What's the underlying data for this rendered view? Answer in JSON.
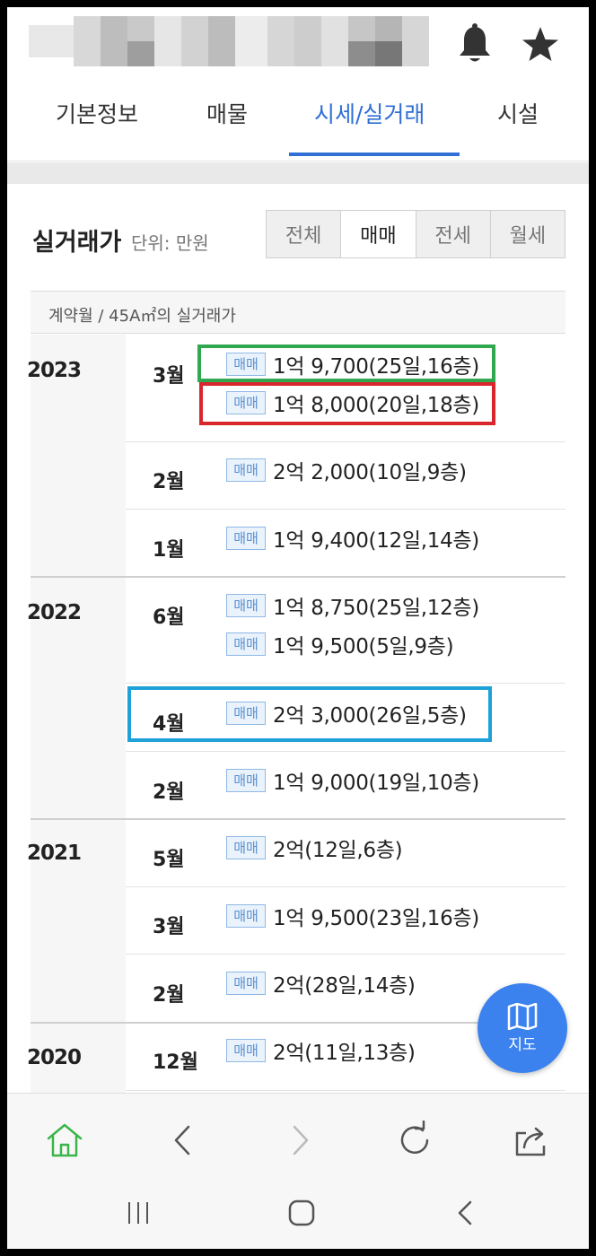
{
  "header": {
    "tabs": [
      {
        "label": "기본정보",
        "active": false
      },
      {
        "label": "매물",
        "active": false
      },
      {
        "label": "시세/실거래",
        "active": true
      },
      {
        "label": "시설",
        "active": false
      }
    ],
    "icons": [
      "bell-icon",
      "star-icon"
    ]
  },
  "section": {
    "title": "실거래가",
    "unit": "단위: 만원",
    "filters": [
      {
        "label": "전체",
        "active": false
      },
      {
        "label": "매매",
        "active": true
      },
      {
        "label": "전세",
        "active": false
      },
      {
        "label": "월세",
        "active": false
      }
    ]
  },
  "table": {
    "header": "계약월 / 45A㎡의 실거래가",
    "badge": "매매",
    "years": [
      {
        "year": "2023",
        "months": [
          {
            "month": "3월",
            "entries": [
              "1억 9,700(25일,16층)",
              "1억 8,000(20일,18층)"
            ]
          },
          {
            "month": "2월",
            "entries": [
              "2억 2,000(10일,9층)"
            ]
          },
          {
            "month": "1월",
            "entries": [
              "1억 9,400(12일,14층)"
            ]
          }
        ]
      },
      {
        "year": "2022",
        "months": [
          {
            "month": "6월",
            "entries": [
              "1억 8,750(25일,12층)",
              "1억 9,500(5일,9층)"
            ]
          },
          {
            "month": "4월",
            "entries": [
              "2억 3,000(26일,5층)"
            ]
          },
          {
            "month": "2월",
            "entries": [
              "1억 9,000(19일,10층)"
            ]
          }
        ]
      },
      {
        "year": "2021",
        "months": [
          {
            "month": "5월",
            "entries": [
              "2억(12일,6층)"
            ]
          },
          {
            "month": "3월",
            "entries": [
              "1억 9,500(23일,16층)"
            ]
          },
          {
            "month": "2월",
            "entries": [
              "2억(28일,14층)"
            ]
          }
        ]
      },
      {
        "year": "2020",
        "months": [
          {
            "month": "12월",
            "entries": [
              "2억(11일,13층)"
            ]
          }
        ]
      }
    ]
  },
  "highlight_colors": {
    "green": "#2fa84f",
    "red": "#d9262c",
    "blue": "#1ea0d8"
  },
  "fab": {
    "label": "지도",
    "icon": "map-icon"
  },
  "colors": {
    "accent": "#2f6fd6",
    "fab": "#3b82ee",
    "home_green": "#3bb54a"
  }
}
